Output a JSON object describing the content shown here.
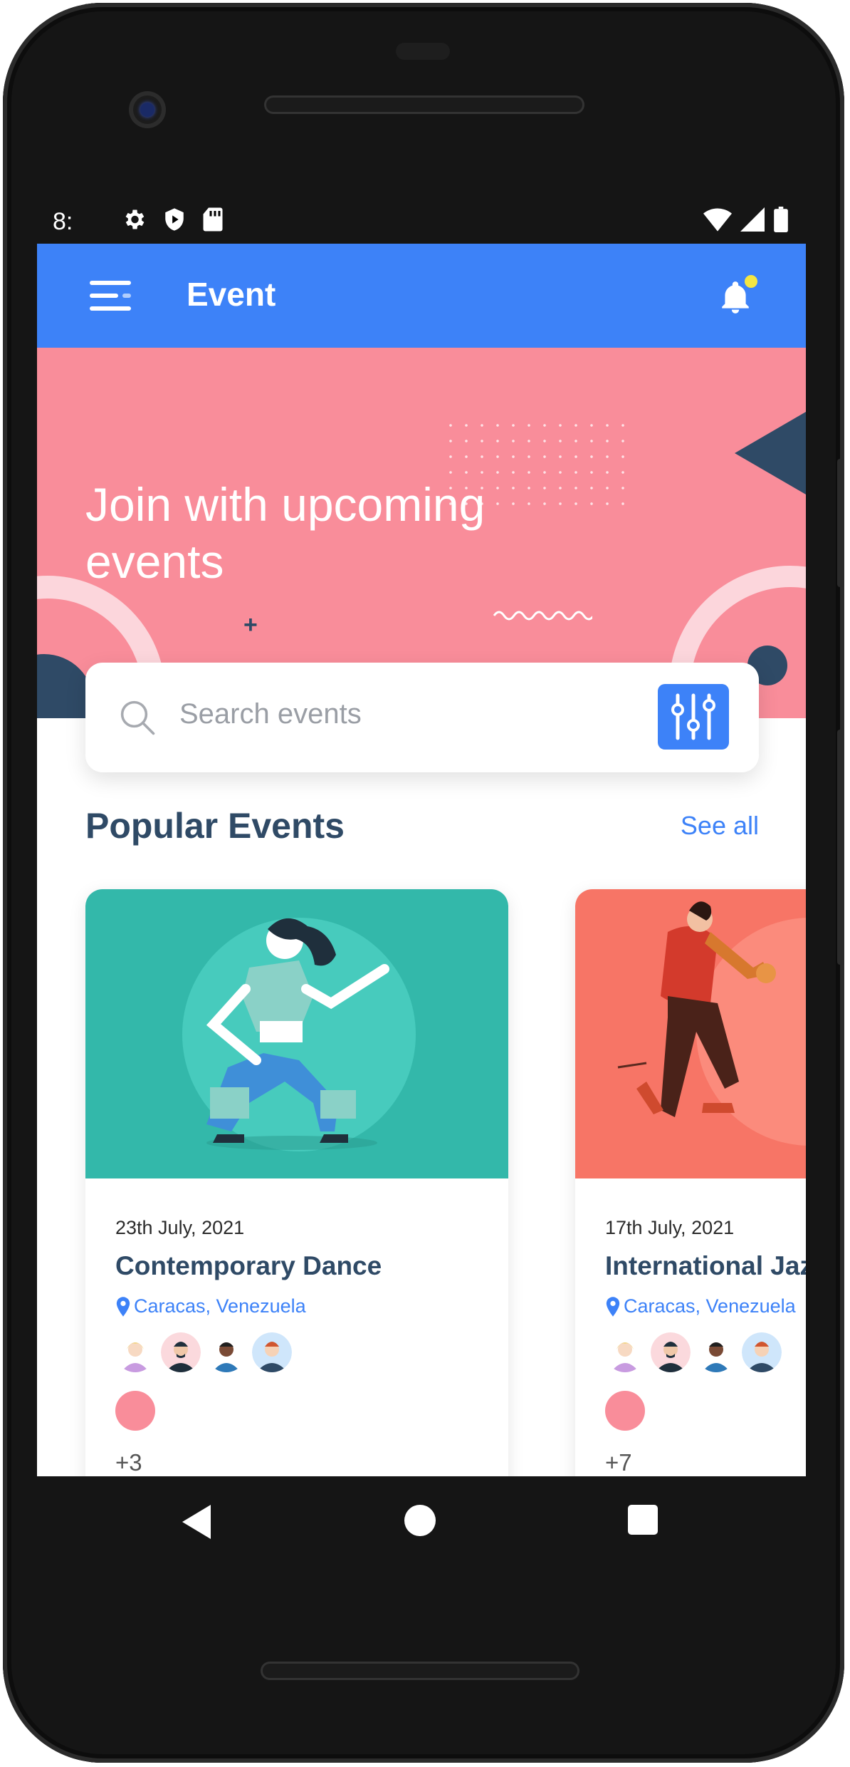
{
  "status_bar": {
    "time": "8:"
  },
  "app_bar": {
    "title": "Event"
  },
  "hero": {
    "headline": "Join with upcoming events"
  },
  "search": {
    "placeholder": "Search events"
  },
  "popular": {
    "title": "Popular Events",
    "see_all": "See all",
    "events": [
      {
        "date": "23th July, 2021",
        "name": "Contemporary Dance",
        "location": "Caracas, Venezuela",
        "more": "+3"
      },
      {
        "date": "17th July, 2021",
        "name": "International Jazz",
        "location": "Caracas, Venezuela",
        "more": "+7"
      }
    ]
  },
  "colors": {
    "primary": "#3d82f8",
    "hero": "#f98d9a",
    "navy": "#2f4a66",
    "teal": "#33b8aa",
    "coral": "#f77566"
  },
  "icons": [
    "menu-icon",
    "bell-icon",
    "search-icon",
    "filter-icon",
    "location-pin-icon",
    "settings-icon",
    "shield-icon",
    "sd-card-icon",
    "wifi-icon",
    "signal-icon",
    "battery-icon",
    "back-icon",
    "home-icon",
    "recents-icon"
  ]
}
